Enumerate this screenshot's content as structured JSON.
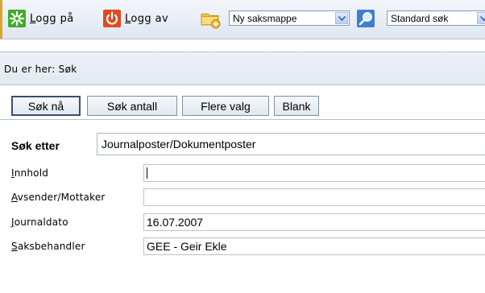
{
  "toolbar": {
    "login_label_u": "L",
    "login_label_rest": "ogg på",
    "logout_label_u": "L",
    "logout_label_rest": "ogg av",
    "folder_select_value": "Ny saksmappe",
    "search_select_value": "Standard søk",
    "icons": [
      "login-icon",
      "logout-icon",
      "new-folder-icon",
      "search-icon",
      "chevron-down-icon"
    ],
    "colors": {
      "login_green": "#3fae2a",
      "logout_red": "#e04a1e",
      "folder_yellow": "#f2c84b"
    }
  },
  "breadcrumb": {
    "text": "Du er her: Søk"
  },
  "actions": {
    "search_now": "Søk nå",
    "search_count": "Søk antall",
    "more_options": "Flere valg",
    "blank": "Blank"
  },
  "form": {
    "search_for_label": "Søk etter",
    "search_for_value": "Journalposter/Dokumentposter",
    "fields": [
      {
        "label_u": "I",
        "label_rest": "nnhold",
        "value": ""
      },
      {
        "label_u": "A",
        "label_rest": "vsender/Mottaker",
        "value": ""
      },
      {
        "label_u": "J",
        "label_rest": "ournaldato",
        "value": "16.07.2007"
      },
      {
        "label_u": "S",
        "label_rest": "aksbehandler",
        "value": "GEE - Geir Ekle"
      }
    ]
  }
}
